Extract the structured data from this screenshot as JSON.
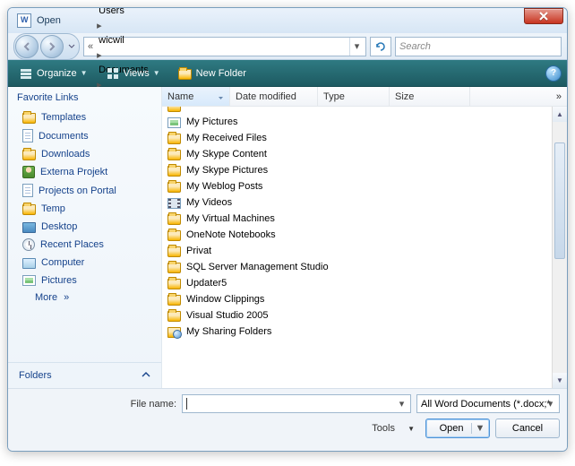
{
  "window": {
    "title": "Open"
  },
  "breadcrumb": [
    "Users",
    "wicwil",
    "Documents"
  ],
  "search": {
    "placeholder": "Search"
  },
  "toolbar": {
    "organize": "Organize",
    "views": "Views",
    "new_folder": "New Folder"
  },
  "sidebar": {
    "header": "Favorite Links",
    "items": [
      {
        "label": "Templates",
        "icon": "folder"
      },
      {
        "label": "Documents",
        "icon": "doc"
      },
      {
        "label": "Downloads",
        "icon": "folder"
      },
      {
        "label": "Externa Projekt",
        "icon": "user"
      },
      {
        "label": "Projects on Portal",
        "icon": "doc"
      },
      {
        "label": "Temp",
        "icon": "folder"
      },
      {
        "label": "Desktop",
        "icon": "desk"
      },
      {
        "label": "Recent Places",
        "icon": "recent"
      },
      {
        "label": "Computer",
        "icon": "comp"
      },
      {
        "label": "Pictures",
        "icon": "pic"
      }
    ],
    "more": "More",
    "folders": "Folders"
  },
  "columns": [
    "Name",
    "Date modified",
    "Type",
    "Size"
  ],
  "files": [
    {
      "name": "My Pictures",
      "icon": "pic"
    },
    {
      "name": "My Received Files",
      "icon": "folder"
    },
    {
      "name": "My Skype Content",
      "icon": "folder"
    },
    {
      "name": "My Skype Pictures",
      "icon": "folder"
    },
    {
      "name": "My Weblog Posts",
      "icon": "folder"
    },
    {
      "name": "My Videos",
      "icon": "vid"
    },
    {
      "name": "My Virtual Machines",
      "icon": "folder"
    },
    {
      "name": "OneNote Notebooks",
      "icon": "folder"
    },
    {
      "name": "Privat",
      "icon": "folder"
    },
    {
      "name": "SQL Server Management Studio",
      "icon": "folder"
    },
    {
      "name": "Updater5",
      "icon": "folder"
    },
    {
      "name": "Window Clippings",
      "icon": "folder"
    },
    {
      "name": "Visual Studio 2005",
      "icon": "folder"
    },
    {
      "name": "My Sharing Folders",
      "icon": "share"
    }
  ],
  "footer": {
    "filename_label": "File name:",
    "filename_value": "",
    "filter": "All Word Documents (*.docx;*",
    "tools": "Tools",
    "open": "Open",
    "cancel": "Cancel"
  }
}
